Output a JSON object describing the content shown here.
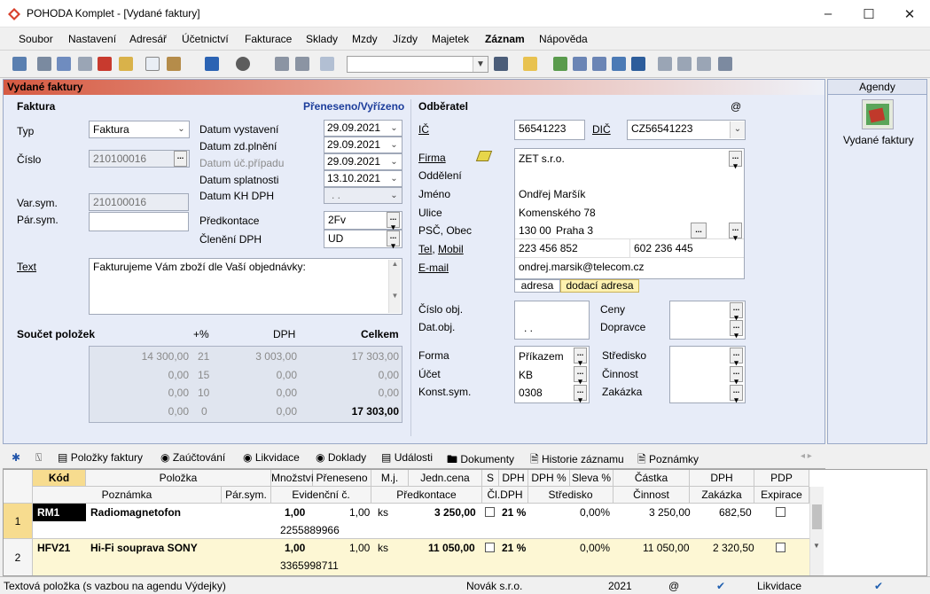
{
  "window": {
    "title": "POHODA Komplet - [Vydané faktury]"
  },
  "menu": [
    "Soubor",
    "Nastavení",
    "Adresář",
    "Účetnictví",
    "Fakturace",
    "Sklady",
    "Mzdy",
    "Jízdy",
    "Majetek",
    "Záznam",
    "Nápověda"
  ],
  "panel": {
    "title": "Vydané faktury",
    "status_link": "Přeneseno/Vyřízeno"
  },
  "faktura": {
    "section": "Faktura",
    "typ_label": "Typ",
    "typ": "Faktura",
    "cislo_label": "Číslo",
    "cislo": "210100016",
    "varsym_label": "Var.sym.",
    "varsym": "210100016",
    "parsym_label": "Pár.sym.",
    "parsym": "",
    "datum_vystaveni_label": "Datum vystavení",
    "datum_vystaveni": "29.09.2021",
    "datum_zdp_label": "Datum zd.plnění",
    "datum_zdp": "29.09.2021",
    "datum_ucp_label": "Datum úč.případu",
    "datum_ucp": "29.09.2021",
    "datum_splatnosti_label": "Datum splatnosti",
    "datum_splatnosti": "13.10.2021",
    "datum_khdph_label": "Datum KH DPH",
    "datum_khdph": ". .",
    "predkontace_label": "Předkontace",
    "predkontace": "2Fv",
    "cleneni_label": "Členění DPH",
    "cleneni": "UD",
    "text_label": "Text",
    "text": "Fakturujeme Vám zboží dle Vaší objednávky:"
  },
  "soucet": {
    "title": "Součet položek",
    "col_pct": "+%",
    "col_dph": "DPH",
    "col_celkem": "Celkem",
    "rows": [
      {
        "zaklad": "14 300,00",
        "pct": "21",
        "dph": "3 003,00",
        "celkem": "17 303,00"
      },
      {
        "zaklad": "0,00",
        "pct": "15",
        "dph": "0,00",
        "celkem": "0,00"
      },
      {
        "zaklad": "0,00",
        "pct": "10",
        "dph": "0,00",
        "celkem": "0,00"
      },
      {
        "zaklad": "0,00",
        "pct": "0",
        "dph": "0,00",
        "celkem": "17 303,00"
      }
    ]
  },
  "odberatel": {
    "section": "Odběratel",
    "at": "@",
    "ic_label": "IČ",
    "ic": "56541223",
    "dic_label": "DIČ",
    "dic": "CZ56541223",
    "firma_label": "Firma",
    "firma": "ZET s.r.o.",
    "oddeleni_label": "Oddělení",
    "jmeno_label": "Jméno",
    "jmeno": "Ondřej Maršík",
    "ulice_label": "Ulice",
    "ulice": "Komenského 78",
    "psc_label": "PSČ, Obec",
    "psc": "130 00",
    "obec": "Praha 3",
    "tel_label": "Tel",
    "mobil_label": "Mobil",
    "tel": "223 456 852",
    "mobil": "602 236 445",
    "email_label": "E-mail",
    "email": "ondrej.marsik@telecom.cz",
    "tab_adresa": "adresa",
    "tab_dodaci": "dodací adresa",
    "cislo_obj_label": "Číslo obj.",
    "dat_obj_label": "Dat.obj.",
    "dat_obj": ". .",
    "ceny_label": "Ceny",
    "dopravce_label": "Dopravce",
    "forma_label": "Forma",
    "forma": "Příkazem",
    "ucet_label": "Účet",
    "ucet": "KB",
    "konst_label": "Konst.sym.",
    "konst": "0308",
    "stredisko_label": "Středisko",
    "cinnost_label": "Činnost",
    "zakazka_label": "Zakázka"
  },
  "agendy": {
    "title": "Agendy",
    "item": "Vydané faktury"
  },
  "tabs": [
    "Položky faktury",
    "Zaúčtování",
    "Likvidace",
    "Doklady",
    "Události",
    "Dokumenty",
    "Historie záznamu",
    "Poznámky"
  ],
  "grid": {
    "head1": [
      "Kód",
      "Položka",
      "Množství",
      "Přeneseno",
      "M.j.",
      "Jedn.cena",
      "S",
      "DPH",
      "DPH %",
      "Sleva %",
      "Částka",
      "DPH",
      "PDP"
    ],
    "head2": [
      "Poznámka",
      "Pár.sym.",
      "Evidenční č.",
      "Předkontace",
      "Čl.DPH",
      "Středisko",
      "Činnost",
      "Zakázka",
      "Expirace"
    ],
    "rows": [
      {
        "num": "1",
        "kod": "RM1",
        "polozka": "Radiomagnetofon",
        "mnozstvi": "1,00",
        "preneseno": "1,00",
        "mj": "ks",
        "cena": "3 250,00",
        "dph": "21 %",
        "sleva": "0,00%",
        "castka": "3 250,00",
        "dphval": "682,50",
        "evid": "2255889966"
      },
      {
        "num": "2",
        "kod": "HFV21",
        "polozka": "Hi-Fi souprava SONY",
        "mnozstvi": "1,00",
        "preneseno": "1,00",
        "mj": "ks",
        "cena": "11 050,00",
        "dph": "21 %",
        "sleva": "0,00%",
        "castka": "11 050,00",
        "dphval": "2 320,50",
        "evid": "3365998711"
      }
    ]
  },
  "status": {
    "text": "Textová položka (s vazbou na agendu Výdejky)",
    "company": "Novák s.r.o.",
    "year": "2021",
    "at": "@",
    "likvidace": "Likvidace"
  }
}
